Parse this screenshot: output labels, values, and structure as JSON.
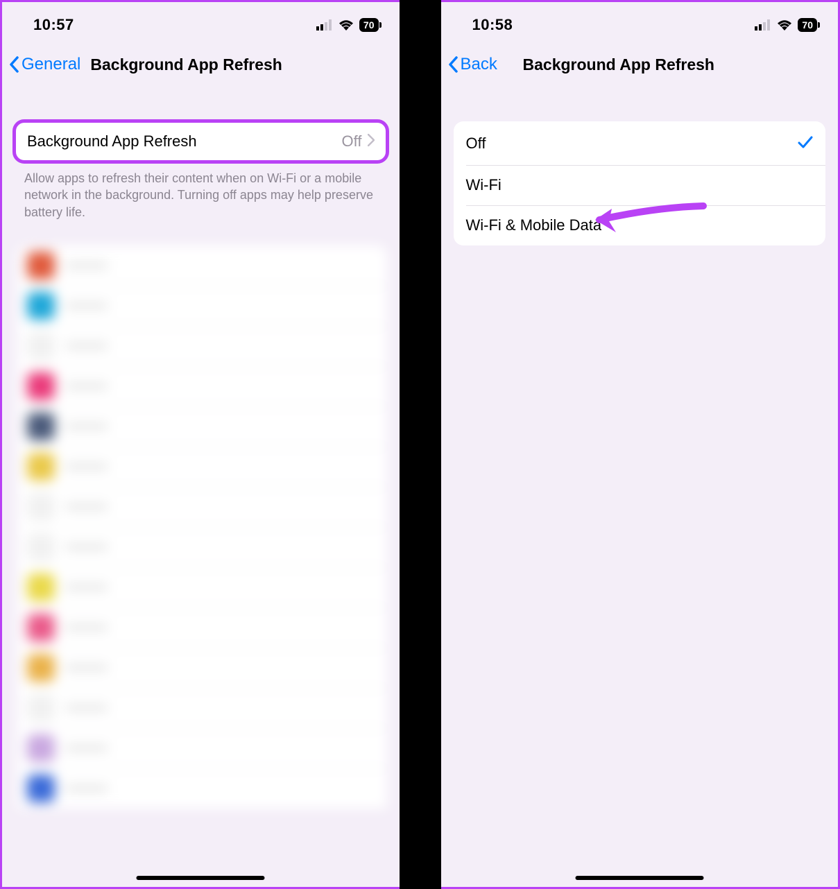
{
  "left": {
    "status": {
      "time": "10:57",
      "battery": "70"
    },
    "nav": {
      "back": "General",
      "title": "Background App Refresh"
    },
    "main_row": {
      "label": "Background App Refresh",
      "value": "Off"
    },
    "footer": "Allow apps to refresh their content when on Wi-Fi or a mobile network in the background. Turning off apps may help preserve battery life.",
    "apps": [
      {
        "color": "#e05a3c"
      },
      {
        "color": "#1ea7d8"
      },
      {
        "color": "#f1f1f1"
      },
      {
        "color": "#ea3a7a"
      },
      {
        "color": "#4a5a7a"
      },
      {
        "color": "#eac94a"
      },
      {
        "color": "#f1f1f1"
      },
      {
        "color": "#f1f1f1"
      },
      {
        "color": "#ead94a"
      },
      {
        "color": "#ea5a8a"
      },
      {
        "color": "#eab24a"
      },
      {
        "color": "#f1f1f1"
      },
      {
        "color": "#c9a8e0"
      },
      {
        "color": "#3a6ad8"
      }
    ]
  },
  "right": {
    "status": {
      "time": "10:58",
      "battery": "70"
    },
    "nav": {
      "back": "Back",
      "title": "Background App Refresh"
    },
    "options": [
      {
        "label": "Off",
        "selected": true
      },
      {
        "label": "Wi-Fi",
        "selected": false
      },
      {
        "label": "Wi-Fi & Mobile Data",
        "selected": false
      }
    ]
  }
}
